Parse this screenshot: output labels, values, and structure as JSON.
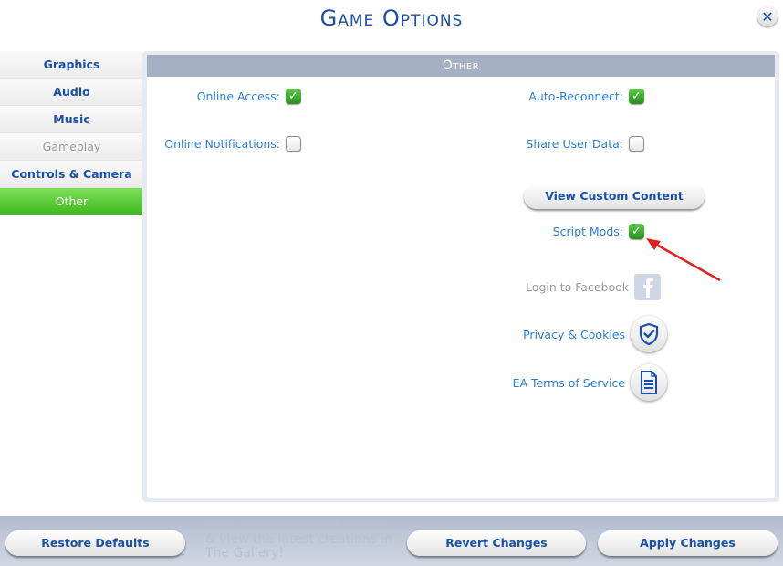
{
  "header": {
    "title": "Game Options",
    "close_icon": "close-icon"
  },
  "sidebar": {
    "items": [
      {
        "label": "Graphics",
        "state": "normal"
      },
      {
        "label": "Audio",
        "state": "normal"
      },
      {
        "label": "Music",
        "state": "normal"
      },
      {
        "label": "Gameplay",
        "state": "disabled"
      },
      {
        "label": "Controls & Camera",
        "state": "normal"
      },
      {
        "label": "Other",
        "state": "active"
      }
    ]
  },
  "panel": {
    "title": "Other",
    "options": {
      "online_access": {
        "label": "Online Access:",
        "checked": true
      },
      "online_notifications": {
        "label": "Online Notifications:",
        "checked": false
      },
      "auto_reconnect": {
        "label": "Auto-Reconnect:",
        "checked": true
      },
      "share_user_data": {
        "label": "Share User Data:",
        "checked": false
      },
      "script_mods": {
        "label": "Script Mods:",
        "checked": true
      }
    },
    "view_custom_content_label": "View Custom Content",
    "links": {
      "facebook": {
        "label": "Login to Facebook",
        "icon": "facebook-icon",
        "enabled": false
      },
      "privacy": {
        "label": "Privacy & Cookies",
        "icon": "shield-check-icon"
      },
      "terms": {
        "label": "EA Terms of Service",
        "icon": "document-icon"
      }
    }
  },
  "footer": {
    "restore_defaults_label": "Restore Defaults",
    "revert_changes_label": "Revert Changes",
    "apply_changes_label": "Apply Changes",
    "background_hint": "Click here to connect online & view the latest creations in The Gallery!"
  },
  "annotation": {
    "arrow_color": "#e02020"
  },
  "colors": {
    "accent_blue": "#1a4fa6",
    "link_blue": "#2a7fd9",
    "active_green": "#3fb81f",
    "header_gray": "#a5b1c2"
  }
}
